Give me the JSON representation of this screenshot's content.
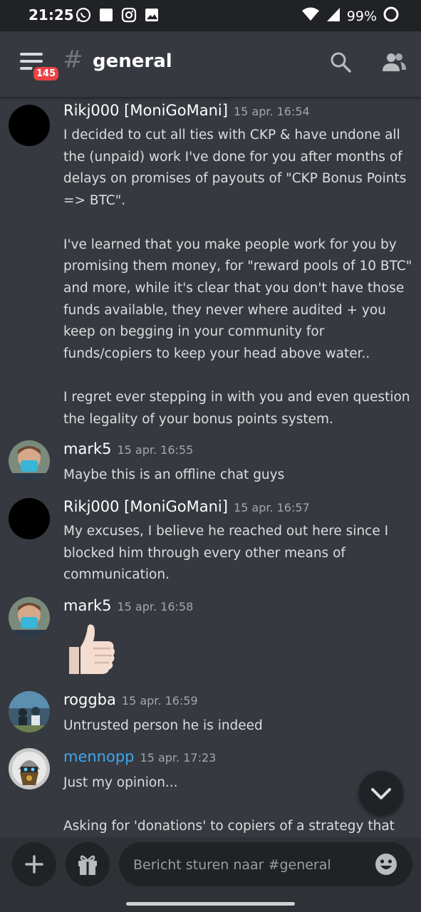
{
  "status_bar": {
    "time": "21:25",
    "battery": "99%"
  },
  "header": {
    "hash_symbol": "#",
    "channel_name": "general",
    "unread_badge": "145"
  },
  "messages": [
    {
      "author": "Rikj000 [MoniGoMani]",
      "timestamp": "15 apr. 16:54",
      "paragraphs": [
        "I decided to cut all ties with CKP & have undone all the (unpaid) work I've done for you after months of delays on promises of payouts of \"CKP Bonus Points => BTC\".",
        "I've learned that you make people work for you by promising them money, for \"reward pools of 10 BTC\" and more, while it's clear that you don't have those funds available, they never where audited + you keep on begging in your community for funds/copiers to keep your head above water..",
        "I regret ever stepping in with you and even question the legality of your bonus points system."
      ]
    },
    {
      "author": "mark5",
      "timestamp": "15 apr. 16:55",
      "paragraphs": [
        "Maybe this is an offline chat guys"
      ]
    },
    {
      "author": "Rikj000 [MoniGoMani]",
      "timestamp": "15 apr. 16:57",
      "paragraphs": [
        "My excuses, I believe he reached out here since I blocked him through every other means of communication."
      ]
    },
    {
      "author": "mark5",
      "timestamp": "15 apr. 16:58",
      "emoji": "thumbs-up"
    },
    {
      "author": "roggba",
      "timestamp": "15 apr. 16:59",
      "paragraphs": [
        "Untrusted person he is indeed"
      ]
    },
    {
      "author": "mennopp",
      "timestamp": "15 apr. 17:23",
      "paragraphs": [
        "Just my opinion...",
        "Asking for 'donations' to copiers of a strategy that"
      ]
    }
  ],
  "composer": {
    "placeholder": "Bericht sturen naar #general"
  },
  "icons": {
    "menu": "hamburger-menu-icon",
    "search": "search-icon",
    "members": "members-icon",
    "add": "plus-icon",
    "gift": "gift-icon",
    "emoji": "emoji-icon",
    "scroll": "chevron-down-icon"
  },
  "colors": {
    "background": "#36393f",
    "header_bg": "#36393f",
    "input_bg": "#202225",
    "badge": "#ed4245",
    "mention_blue": "#3ea6f0",
    "timestamp": "#a3a6aa"
  }
}
